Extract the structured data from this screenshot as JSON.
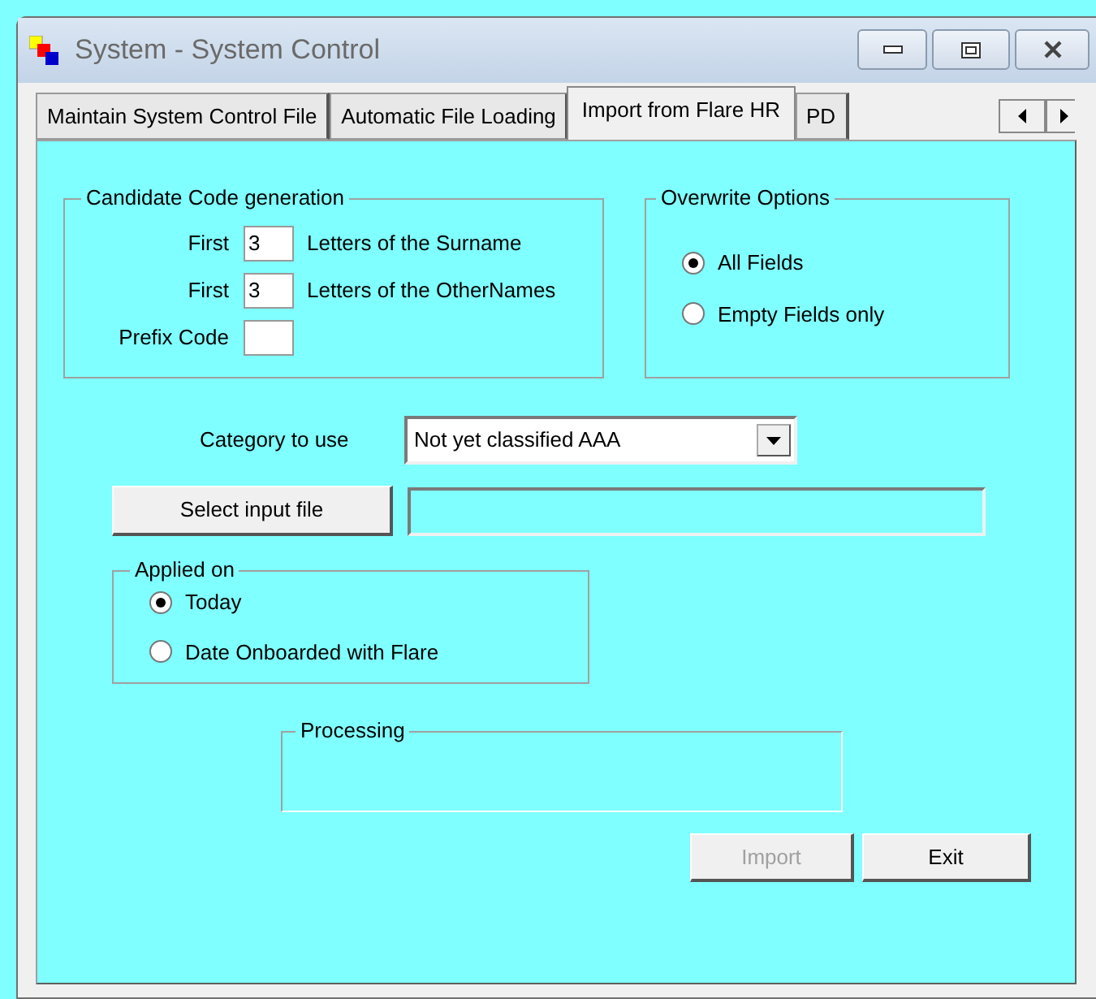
{
  "window": {
    "title": "System - System Control"
  },
  "tabs": [
    {
      "label": "Maintain System Control File",
      "selected": false
    },
    {
      "label": "Automatic File Loading",
      "selected": false
    },
    {
      "label": "Import from Flare HR",
      "selected": true
    },
    {
      "label": "PD",
      "selected": false
    }
  ],
  "candidate_code_generation": {
    "title": "Candidate Code generation",
    "rows": [
      {
        "label": "First",
        "value": "3",
        "suffix": "Letters of the Surname"
      },
      {
        "label": "First",
        "value": "3",
        "suffix": "Letters of the OtherNames"
      },
      {
        "label": "Prefix Code"
      }
    ]
  },
  "overwrite_options": {
    "title": "Overwrite Options",
    "options": [
      {
        "label": "All Fields",
        "selected": true
      },
      {
        "label": "Empty Fields only",
        "selected": false
      }
    ]
  },
  "category": {
    "label": "Category to use",
    "value": "Not yet classified AAA"
  },
  "input_file": {
    "button": "Select input file"
  },
  "applied_on": {
    "title": "Applied on",
    "options": [
      {
        "label": "Today",
        "selected": true
      },
      {
        "label": "Date Onboarded with Flare",
        "selected": false
      }
    ]
  },
  "processing": {
    "title": "Processing"
  },
  "buttons": [
    {
      "label": "Import",
      "disabled": true
    },
    {
      "label": "Exit",
      "disabled": false
    }
  ]
}
